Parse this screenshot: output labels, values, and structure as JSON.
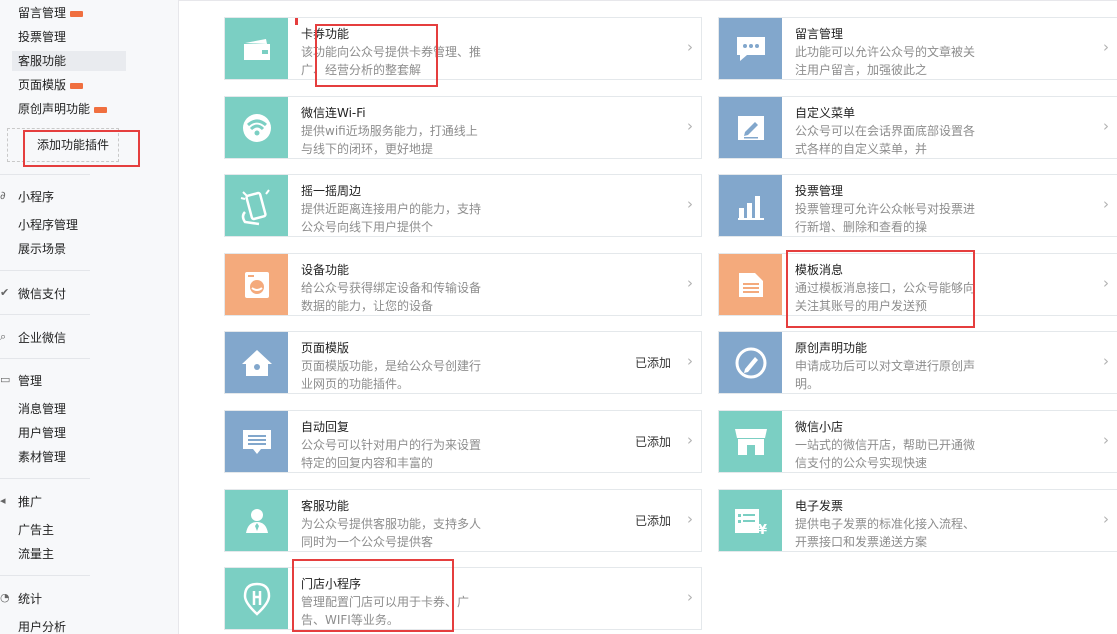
{
  "sidebar": {
    "items_top": [
      {
        "label": "留言管理",
        "badge": true
      },
      {
        "label": "投票管理",
        "badge": false
      },
      {
        "label": "客服功能",
        "badge": false,
        "active": true
      },
      {
        "label": "页面模版",
        "badge": true
      },
      {
        "label": "原创声明功能",
        "badge": true
      }
    ],
    "add_plugin": "添加功能插件",
    "sections": [
      {
        "head": "小程序",
        "icon": "link-icon",
        "items": [
          "小程序管理",
          "展示场景"
        ]
      },
      {
        "head": "微信支付",
        "icon": "wechat-pay-icon",
        "items": []
      },
      {
        "head": "企业微信",
        "icon": "search-icon",
        "items": []
      },
      {
        "head": "管理",
        "icon": "manage-icon",
        "items": [
          "消息管理",
          "用户管理",
          "素材管理"
        ]
      },
      {
        "head": "推广",
        "icon": "promote-icon",
        "items": [
          "广告主",
          "流量主"
        ]
      },
      {
        "head": "统计",
        "icon": "stats-icon",
        "items": [
          "用户分析"
        ]
      }
    ]
  },
  "cards": [
    {
      "title": "卡券功能",
      "desc": "该功能向公众号提供卡券管理、推广、经营分析的整套解",
      "status": "",
      "icon": "card-icon",
      "color": "teal"
    },
    {
      "title": "留言管理",
      "desc": "此功能可以允许公众号的文章被关注用户留言，加强彼此之",
      "status": "",
      "icon": "comment-icon",
      "color": "blue"
    },
    {
      "title": "微信连Wi-Fi",
      "desc": "提供wifi近场服务能力，打通线上与线下的闭环，更好地提",
      "status": "",
      "icon": "wifi-icon",
      "color": "teal"
    },
    {
      "title": "自定义菜单",
      "desc": "公众号可以在会话界面底部设置各式各样的自定义菜单，并",
      "status": "",
      "icon": "edit-icon",
      "color": "blue"
    },
    {
      "title": "摇一摇周边",
      "desc": "提供近距离连接用户的能力，支持公众号向线下用户提供个",
      "status": "",
      "icon": "shake-icon",
      "color": "teal"
    },
    {
      "title": "投票管理",
      "desc": "投票管理可允许公众帐号对投票进行新增、删除和查看的操",
      "status": "",
      "icon": "bar-chart-icon",
      "color": "blue"
    },
    {
      "title": "设备功能",
      "desc": "给公众号获得绑定设备和传输设备数据的能力，让您的设备",
      "status": "",
      "icon": "device-icon",
      "color": "orange"
    },
    {
      "title": "模板消息",
      "desc": "通过模板消息接口，公众号能够向关注其账号的用户发送预",
      "status": "",
      "icon": "document-icon",
      "color": "orange"
    },
    {
      "title": "页面模版",
      "desc": "页面模版功能，是给公众号创建行业网页的功能插件。",
      "status": "已添加",
      "icon": "home-icon",
      "color": "blue"
    },
    {
      "title": "原创声明功能",
      "desc": "申请成功后可以对文章进行原创声明。",
      "status": "",
      "icon": "pen-circle-icon",
      "color": "blue"
    },
    {
      "title": "自动回复",
      "desc": "公众号可以针对用户的行为来设置特定的回复内容和丰富的",
      "status": "已添加",
      "icon": "message-icon",
      "color": "blue"
    },
    {
      "title": "微信小店",
      "desc": "一站式的微信开店，帮助已开通微信支付的公众号实现快速",
      "status": "",
      "icon": "shop-icon",
      "color": "teal"
    },
    {
      "title": "客服功能",
      "desc": "为公众号提供客服功能，支持多人同时为一个公众号提供客",
      "status": "已添加",
      "icon": "user-icon",
      "color": "teal"
    },
    {
      "title": "电子发票",
      "desc": "提供电子发票的标准化接入流程、开票接口和发票递送方案",
      "status": "",
      "icon": "invoice-icon",
      "color": "teal"
    },
    {
      "title": "门店小程序",
      "desc": "管理配置门店可以用于卡券、广告、WIFI等业务。",
      "status": "",
      "icon": "store-pin-icon",
      "color": "teal"
    }
  ],
  "arrow": "›"
}
